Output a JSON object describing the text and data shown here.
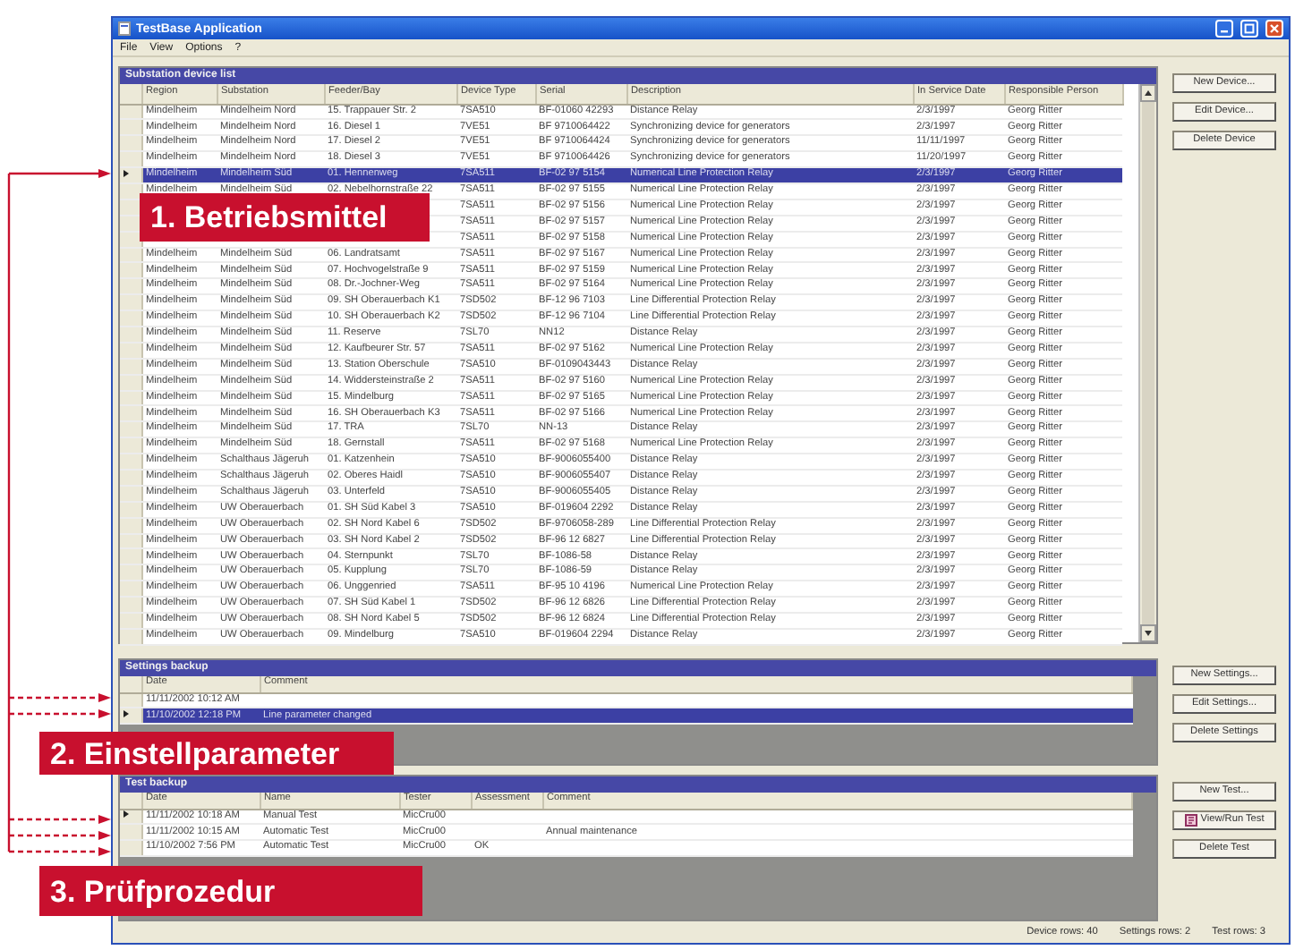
{
  "window": {
    "title": "TestBase Application"
  },
  "menu": [
    "File",
    "View",
    "Options",
    "?"
  ],
  "device_list": {
    "title": "Substation device list",
    "columns": [
      "Region",
      "Substation",
      "Feeder/Bay",
      "Device Type",
      "Serial",
      "Description",
      "In Service Date",
      "Responsible Person"
    ],
    "rows": [
      {
        "region": "Mindelheim",
        "substation": "Mindelheim Nord",
        "feeder": "15. Trappauer Str. 2",
        "device_type": "7SA510",
        "serial": "BF-01060 42293",
        "description": "Distance Relay",
        "in_service_date": "2/3/1997",
        "responsible_person": "Georg Ritter",
        "selected": false,
        "current": false
      },
      {
        "region": "Mindelheim",
        "substation": "Mindelheim Nord",
        "feeder": "16. Diesel 1",
        "device_type": "7VE51",
        "serial": "BF 9710064422",
        "description": "Synchronizing device for generators",
        "in_service_date": "2/3/1997",
        "responsible_person": "Georg Ritter",
        "selected": false,
        "current": false
      },
      {
        "region": "Mindelheim",
        "substation": "Mindelheim Nord",
        "feeder": "17. Diesel 2",
        "device_type": "7VE51",
        "serial": "BF 9710064424",
        "description": "Synchronizing device for generators",
        "in_service_date": "11/11/1997",
        "responsible_person": "Georg Ritter",
        "selected": false,
        "current": false
      },
      {
        "region": "Mindelheim",
        "substation": "Mindelheim Nord",
        "feeder": "18. Diesel 3",
        "device_type": "7VE51",
        "serial": "BF 9710064426",
        "description": "Synchronizing device for generators",
        "in_service_date": "11/20/1997",
        "responsible_person": "Georg Ritter",
        "selected": false,
        "current": false
      },
      {
        "region": "Mindelheim",
        "substation": "Mindelheim Süd",
        "feeder": "01. Hennenweg",
        "device_type": "7SA511",
        "serial": "BF-02 97 5154",
        "description": "Numerical Line Protection Relay",
        "in_service_date": "2/3/1997",
        "responsible_person": "Georg Ritter",
        "selected": true,
        "current": true
      },
      {
        "region": "Mindelheim",
        "substation": "Mindelheim Süd",
        "feeder": "02. Nebelhornstraße 22",
        "device_type": "7SA511",
        "serial": "BF-02 97 5155",
        "description": "Numerical Line Protection Relay",
        "in_service_date": "2/3/1997",
        "responsible_person": "Georg Ritter",
        "selected": false,
        "current": false
      },
      {
        "device_type": "7SA511",
        "serial": "BF-02 97 5156",
        "description": "Numerical Line Protection Relay",
        "in_service_date": "2/3/1997",
        "responsible_person": "Georg Ritter",
        "selected": false,
        "current": false
      },
      {
        "device_type": "7SA511",
        "serial": "BF-02 97 5157",
        "description": "Numerical Line Protection Relay",
        "in_service_date": "2/3/1997",
        "responsible_person": "Georg Ritter",
        "selected": false,
        "current": false
      },
      {
        "device_type": "7SA511",
        "serial": "BF-02 97 5158",
        "description": "Numerical Line Protection Relay",
        "in_service_date": "2/3/1997",
        "responsible_person": "Georg Ritter",
        "selected": false,
        "current": false
      },
      {
        "region": "Mindelheim",
        "substation": "Mindelheim Süd",
        "feeder": "06. Landratsamt",
        "device_type": "7SA511",
        "serial": "BF-02 97 5167",
        "description": "Numerical Line Protection Relay",
        "in_service_date": "2/3/1997",
        "responsible_person": "Georg Ritter",
        "selected": false,
        "current": false
      },
      {
        "region": "Mindelheim",
        "substation": "Mindelheim Süd",
        "feeder": "07. Hochvogelstraße 9",
        "device_type": "7SA511",
        "serial": "BF-02 97 5159",
        "description": "Numerical Line Protection Relay",
        "in_service_date": "2/3/1997",
        "responsible_person": "Georg Ritter",
        "selected": false,
        "current": false
      },
      {
        "region": "Mindelheim",
        "substation": "Mindelheim Süd",
        "feeder": "08. Dr.-Jochner-Weg",
        "device_type": "7SA511",
        "serial": "BF-02 97 5164",
        "description": "Numerical Line Protection Relay",
        "in_service_date": "2/3/1997",
        "responsible_person": "Georg Ritter",
        "selected": false,
        "current": false
      },
      {
        "region": "Mindelheim",
        "substation": "Mindelheim Süd",
        "feeder": "09. SH Oberauerbach K1",
        "device_type": "7SD502",
        "serial": "BF-12 96 7103",
        "description": "Line Differential Protection Relay",
        "in_service_date": "2/3/1997",
        "responsible_person": "Georg Ritter",
        "selected": false,
        "current": false
      },
      {
        "region": "Mindelheim",
        "substation": "Mindelheim Süd",
        "feeder": "10. SH Oberauerbach K2",
        "device_type": "7SD502",
        "serial": "BF-12 96 7104",
        "description": "Line Differential Protection Relay",
        "in_service_date": "2/3/1997",
        "responsible_person": "Georg Ritter",
        "selected": false,
        "current": false
      },
      {
        "region": "Mindelheim",
        "substation": "Mindelheim Süd",
        "feeder": "11. Reserve",
        "device_type": "7SL70",
        "serial": "NN12",
        "description": "Distance Relay",
        "in_service_date": "2/3/1997",
        "responsible_person": "Georg Ritter",
        "selected": false,
        "current": false
      },
      {
        "region": "Mindelheim",
        "substation": "Mindelheim Süd",
        "feeder": "12. Kaufbeurer Str. 57",
        "device_type": "7SA511",
        "serial": "BF-02 97 5162",
        "description": "Numerical Line Protection Relay",
        "in_service_date": "2/3/1997",
        "responsible_person": "Georg Ritter",
        "selected": false,
        "current": false
      },
      {
        "region": "Mindelheim",
        "substation": "Mindelheim Süd",
        "feeder": "13. Station Oberschule",
        "device_type": "7SA510",
        "serial": "BF-0109043443",
        "description": "Distance Relay",
        "in_service_date": "2/3/1997",
        "responsible_person": "Georg Ritter",
        "selected": false,
        "current": false
      },
      {
        "region": "Mindelheim",
        "substation": "Mindelheim Süd",
        "feeder": "14. Widdersteinstraße 2",
        "device_type": "7SA511",
        "serial": "BF-02 97 5160",
        "description": "Numerical Line Protection Relay",
        "in_service_date": "2/3/1997",
        "responsible_person": "Georg Ritter",
        "selected": false,
        "current": false
      },
      {
        "region": "Mindelheim",
        "substation": "Mindelheim Süd",
        "feeder": "15. Mindelburg",
        "device_type": "7SA511",
        "serial": "BF-02 97 5165",
        "description": "Numerical Line Protection Relay",
        "in_service_date": "2/3/1997",
        "responsible_person": "Georg Ritter",
        "selected": false,
        "current": false
      },
      {
        "region": "Mindelheim",
        "substation": "Mindelheim Süd",
        "feeder": "16. SH Oberauerbach K3",
        "device_type": "7SA511",
        "serial": "BF-02 97 5166",
        "description": "Numerical Line Protection Relay",
        "in_service_date": "2/3/1997",
        "responsible_person": "Georg Ritter",
        "selected": false,
        "current": false
      },
      {
        "region": "Mindelheim",
        "substation": "Mindelheim Süd",
        "feeder": "17. TRA",
        "device_type": "7SL70",
        "serial": "NN-13",
        "description": "Distance Relay",
        "in_service_date": "2/3/1997",
        "responsible_person": "Georg Ritter",
        "selected": false,
        "current": false
      },
      {
        "region": "Mindelheim",
        "substation": "Mindelheim Süd",
        "feeder": "18. Gernstall",
        "device_type": "7SA511",
        "serial": "BF-02 97 5168",
        "description": "Numerical Line Protection Relay",
        "in_service_date": "2/3/1997",
        "responsible_person": "Georg Ritter",
        "selected": false,
        "current": false
      },
      {
        "region": "Mindelheim",
        "substation": "Schalthaus Jägeruh",
        "feeder": "01. Katzenhein",
        "device_type": "7SA510",
        "serial": "BF-9006055400",
        "description": "Distance Relay",
        "in_service_date": "2/3/1997",
        "responsible_person": "Georg Ritter",
        "selected": false,
        "current": false
      },
      {
        "region": "Mindelheim",
        "substation": "Schalthaus Jägeruh",
        "feeder": "02. Oberes Haidl",
        "device_type": "7SA510",
        "serial": "BF-9006055407",
        "description": "Distance Relay",
        "in_service_date": "2/3/1997",
        "responsible_person": "Georg Ritter",
        "selected": false,
        "current": false
      },
      {
        "region": "Mindelheim",
        "substation": "Schalthaus Jägeruh",
        "feeder": "03. Unterfeld",
        "device_type": "7SA510",
        "serial": "BF-9006055405",
        "description": "Distance Relay",
        "in_service_date": "2/3/1997",
        "responsible_person": "Georg Ritter",
        "selected": false,
        "current": false
      },
      {
        "region": "Mindelheim",
        "substation": "UW Oberauerbach",
        "feeder": "01. SH Süd Kabel 3",
        "device_type": "7SA510",
        "serial": "BF-019604 2292",
        "description": "Distance Relay",
        "in_service_date": "2/3/1997",
        "responsible_person": "Georg Ritter",
        "selected": false,
        "current": false
      },
      {
        "region": "Mindelheim",
        "substation": "UW Oberauerbach",
        "feeder": "02. SH Nord Kabel 6",
        "device_type": "7SD502",
        "serial": "BF-9706058-289",
        "description": "Line Differential Protection Relay",
        "in_service_date": "2/3/1997",
        "responsible_person": "Georg Ritter",
        "selected": false,
        "current": false
      },
      {
        "region": "Mindelheim",
        "substation": "UW Oberauerbach",
        "feeder": "03. SH Nord Kabel 2",
        "device_type": "7SD502",
        "serial": "BF-96 12 6827",
        "description": "Line Differential Protection Relay",
        "in_service_date": "2/3/1997",
        "responsible_person": "Georg Ritter",
        "selected": false,
        "current": false
      },
      {
        "region": "Mindelheim",
        "substation": "UW Oberauerbach",
        "feeder": "04. Sternpunkt",
        "device_type": "7SL70",
        "serial": "BF-1086-58",
        "description": "Distance Relay",
        "in_service_date": "2/3/1997",
        "responsible_person": "Georg Ritter",
        "selected": false,
        "current": false
      },
      {
        "region": "Mindelheim",
        "substation": "UW Oberauerbach",
        "feeder": "05. Kupplung",
        "device_type": "7SL70",
        "serial": "BF-1086-59",
        "description": "Distance Relay",
        "in_service_date": "2/3/1997",
        "responsible_person": "Georg Ritter",
        "selected": false,
        "current": false
      },
      {
        "region": "Mindelheim",
        "substation": "UW Oberauerbach",
        "feeder": "06. Unggenried",
        "device_type": "7SA511",
        "serial": "BF-95 10 4196",
        "description": "Numerical Line Protection Relay",
        "in_service_date": "2/3/1997",
        "responsible_person": "Georg Ritter",
        "selected": false,
        "current": false
      },
      {
        "region": "Mindelheim",
        "substation": "UW Oberauerbach",
        "feeder": "07. SH Süd Kabel 1",
        "device_type": "7SD502",
        "serial": "BF-96 12 6826",
        "description": "Line Differential Protection Relay",
        "in_service_date": "2/3/1997",
        "responsible_person": "Georg Ritter",
        "selected": false,
        "current": false
      },
      {
        "region": "Mindelheim",
        "substation": "UW Oberauerbach",
        "feeder": "08. SH Nord Kabel 5",
        "device_type": "7SD502",
        "serial": "BF-96 12 6824",
        "description": "Line Differential Protection Relay",
        "in_service_date": "2/3/1997",
        "responsible_person": "Georg Ritter",
        "selected": false,
        "current": false
      },
      {
        "region": "Mindelheim",
        "substation": "UW Oberauerbach",
        "feeder": "09. Mindelburg",
        "device_type": "7SA510",
        "serial": "BF-019604 2294",
        "description": "Distance Relay",
        "in_service_date": "2/3/1997",
        "responsible_person": "Georg Ritter",
        "selected": false,
        "current": false
      }
    ],
    "buttons": [
      "New Device...",
      "Edit Device...",
      "Delete Device"
    ]
  },
  "settings_backup": {
    "title": "Settings backup",
    "columns": [
      "Date",
      "Comment"
    ],
    "rows": [
      {
        "date": "11/11/2002 10:12 AM",
        "selected": false,
        "current": false
      },
      {
        "date": "11/10/2002 12:18 PM",
        "comment": "Line parameter changed",
        "selected": true,
        "current": true
      }
    ],
    "buttons": [
      "New Settings...",
      "Edit Settings...",
      "Delete Settings"
    ]
  },
  "test_backup": {
    "title": "Test backup",
    "columns": [
      "Date",
      "Name",
      "Tester",
      "Assessment",
      "Comment"
    ],
    "rows": [
      {
        "date": "11/11/2002 10:18 AM",
        "name": "Manual Test",
        "tester": "MicCru00",
        "selected": false,
        "current": true
      },
      {
        "date": "11/11/2002 10:15 AM",
        "name": "Automatic Test",
        "tester": "MicCru00",
        "comment": "Annual maintenance",
        "selected": false,
        "current": false
      },
      {
        "date": "11/10/2002 7:56 PM",
        "name": "Automatic Test",
        "tester": "MicCru00",
        "assessment": "OK",
        "selected": false,
        "current": false
      }
    ],
    "buttons": [
      {
        "label": "New Test...",
        "kind": "plain"
      },
      {
        "label": "View/Run Test",
        "kind": "icon"
      },
      {
        "label": "Delete Test",
        "kind": "plain"
      }
    ]
  },
  "status_bar": [
    "Device rows: 40",
    "Settings rows: 2",
    "Test rows: 3"
  ],
  "annotations": [
    "1. Betriebsmittel",
    "2. Einstellparameter",
    "3. Prüfprozedur"
  ]
}
